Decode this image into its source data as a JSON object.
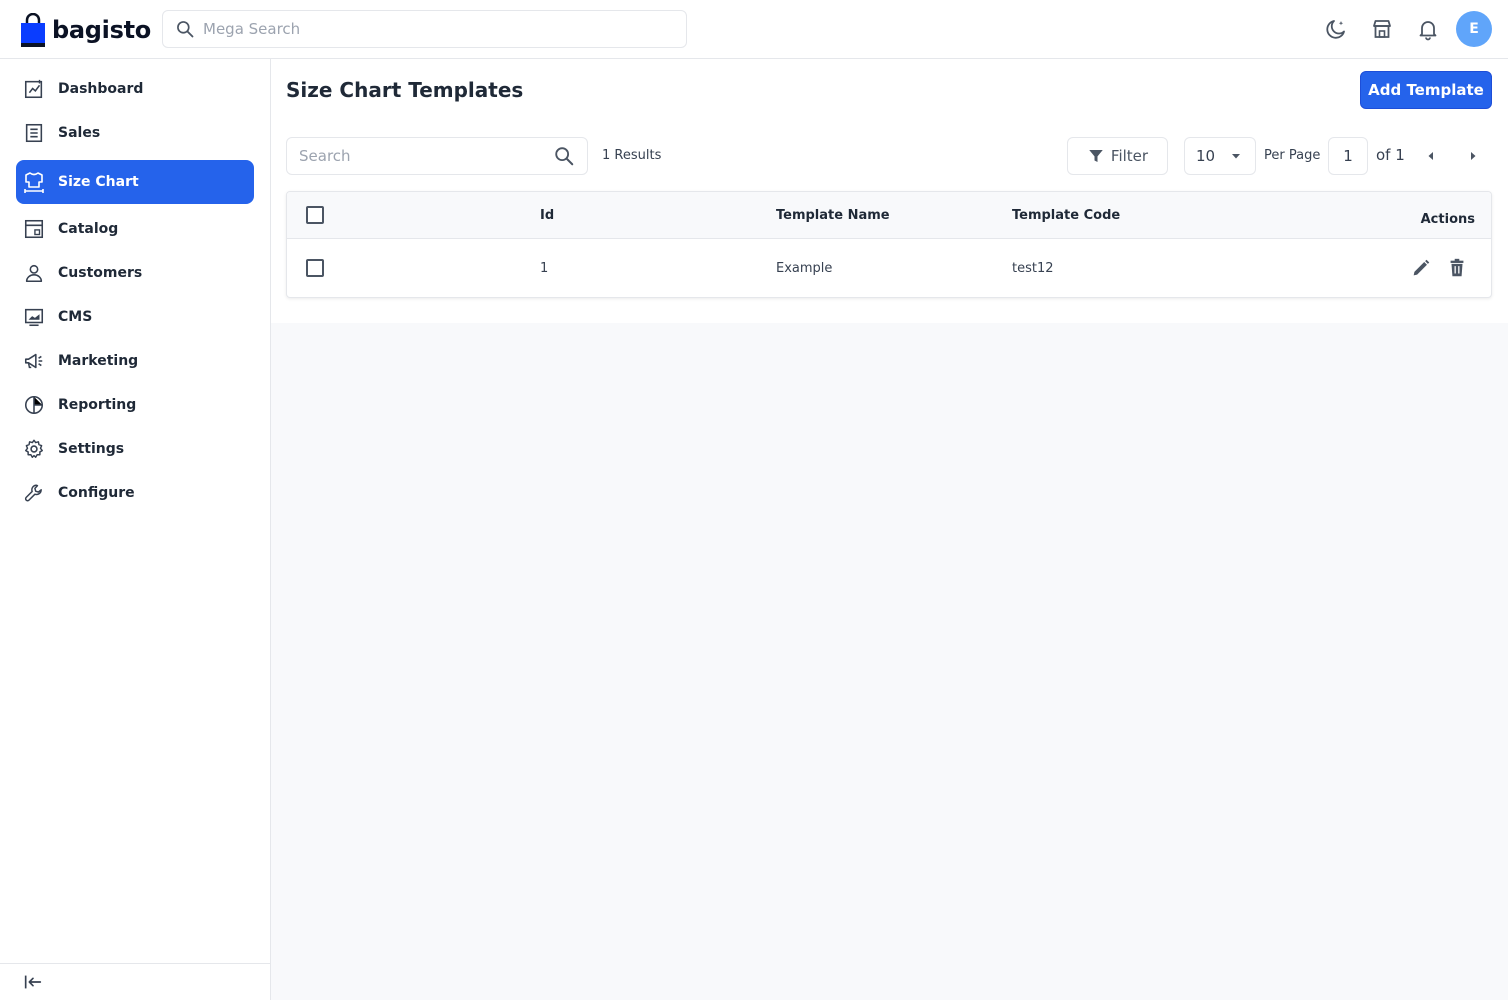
{
  "header": {
    "brand": "bagisto",
    "search_placeholder": "Mega Search",
    "avatar_initial": "E"
  },
  "sidebar": {
    "items": [
      {
        "label": "Dashboard",
        "icon": "dashboard-icon",
        "active": false
      },
      {
        "label": "Sales",
        "icon": "sales-icon",
        "active": false
      },
      {
        "label": "Size Chart",
        "icon": "size-chart-icon",
        "active": true
      },
      {
        "label": "Catalog",
        "icon": "catalog-icon",
        "active": false
      },
      {
        "label": "Customers",
        "icon": "customers-icon",
        "active": false
      },
      {
        "label": "CMS",
        "icon": "cms-icon",
        "active": false
      },
      {
        "label": "Marketing",
        "icon": "marketing-icon",
        "active": false
      },
      {
        "label": "Reporting",
        "icon": "reporting-icon",
        "active": false
      },
      {
        "label": "Settings",
        "icon": "settings-icon",
        "active": false
      },
      {
        "label": "Configure",
        "icon": "configure-icon",
        "active": false
      }
    ]
  },
  "page": {
    "title": "Size Chart Templates",
    "add_button": "Add Template"
  },
  "toolbar": {
    "search_placeholder": "Search",
    "results": "1 Results",
    "filter_label": "Filter",
    "per_page_value": "10",
    "per_page_label": "Per Page",
    "current_page": "1",
    "of_total": "of 1"
  },
  "table": {
    "columns": [
      "Id",
      "Template Name",
      "Template Code",
      "Actions"
    ],
    "rows": [
      {
        "id": "1",
        "name": "Example",
        "code": "test12"
      }
    ]
  },
  "colors": {
    "accent": "#2563eb",
    "avatar": "#60a5fa"
  }
}
